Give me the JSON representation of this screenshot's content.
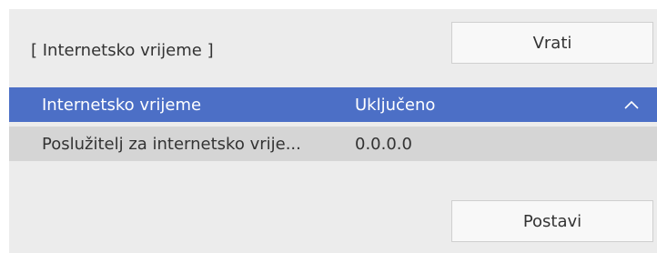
{
  "header": {
    "section_title": "[ Internetsko vrijeme ]",
    "back_label": "Vrati"
  },
  "rows": [
    {
      "label": "Internetsko vrijeme",
      "value": "Uključeno",
      "selected": true,
      "icon": "chevron-up-icon"
    },
    {
      "label": "Poslužitelj za internetsko vrije...",
      "value": "0.0.0.0",
      "selected": false
    }
  ],
  "footer": {
    "set_label": "Postavi"
  },
  "colors": {
    "panel_bg": "#ececec",
    "selected_row": "#4c6fc6",
    "normal_row": "#d5d5d5",
    "button_bg": "#f8f8f8"
  }
}
